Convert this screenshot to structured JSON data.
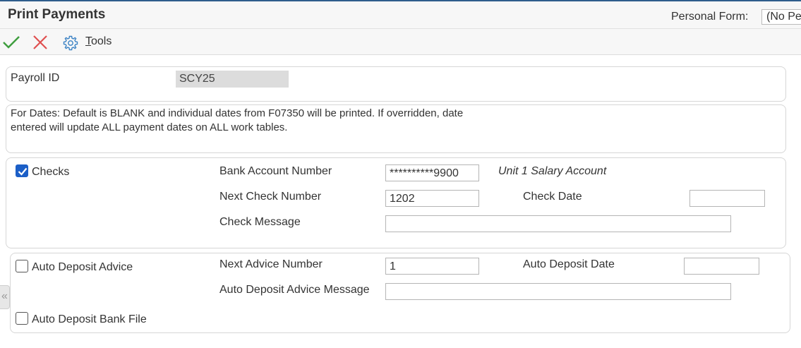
{
  "header": {
    "title": "Print Payments",
    "personal_form_label": "Personal Form:",
    "personal_form_value": "(No Pe"
  },
  "toolbar": {
    "ok_icon": "checkmark-icon",
    "cancel_icon": "close-icon",
    "tools_icon": "gear-icon",
    "tools_label_first": "T",
    "tools_label_rest": "ools"
  },
  "payroll": {
    "label": "Payroll ID",
    "value": "SCY25"
  },
  "dates_note": {
    "line1": "For Dates: Default is BLANK and individual dates from F07350 will be printed. If overridden, date",
    "line2": "entered will update ALL payment dates on ALL work tables."
  },
  "checks": {
    "label": "Checks",
    "checked": true,
    "bank_account_label": "Bank Account Number",
    "bank_account_value": "**********9900",
    "bank_account_description": "Unit 1 Salary Account",
    "next_check_label": "Next Check Number",
    "next_check_value": "1202",
    "check_date_label": "Check Date",
    "check_date_value": "",
    "check_message_label": "Check Message",
    "check_message_value": ""
  },
  "auto_deposit": {
    "advice_label": "Auto Deposit Advice",
    "advice_checked": false,
    "next_advice_label": "Next Advice Number",
    "next_advice_value": "1",
    "date_label": "Auto Deposit Date",
    "date_value": "",
    "message_label": "Auto Deposit Advice Message",
    "message_value": "",
    "bank_file_label": "Auto Deposit Bank File",
    "bank_file_checked": false
  },
  "sidebar_toggle": "«",
  "colors": {
    "accent": "#1c5fc7",
    "ok_green": "#3f9e3f",
    "cancel_red": "#e05050",
    "gear_blue": "#3b82c4"
  }
}
